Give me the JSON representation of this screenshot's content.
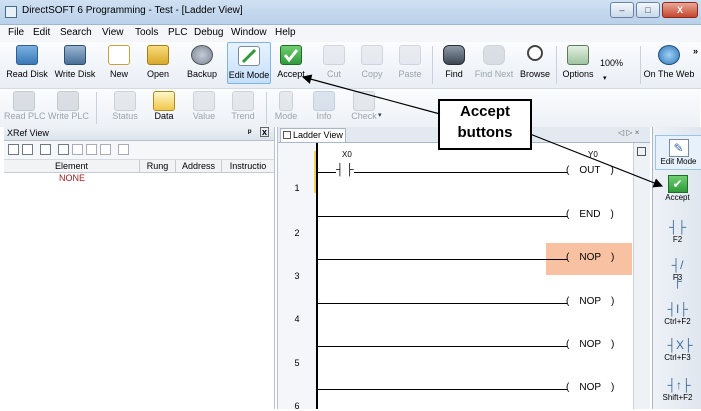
{
  "window": {
    "title": "DirectSOFT 6 Programming - Test - [Ladder View]",
    "min_label": "–",
    "max_label": "□",
    "close_label": "X"
  },
  "menu": [
    "File",
    "Edit",
    "Search",
    "View",
    "Tools",
    "PLC",
    "Debug",
    "Window",
    "Help"
  ],
  "toolbar1": {
    "items": [
      {
        "label": "Read Disk",
        "icon": "read-disk-icon",
        "enabled": true
      },
      {
        "label": "Write Disk",
        "icon": "write-disk-icon",
        "enabled": true
      },
      {
        "label": "New",
        "icon": "new-icon",
        "enabled": true
      },
      {
        "label": "Open",
        "icon": "open-folder-icon",
        "enabled": true
      },
      {
        "label": "Backup",
        "icon": "backup-icon",
        "enabled": true
      },
      {
        "label": "Edit Mode",
        "icon": "edit-mode-icon",
        "enabled": true,
        "selected": true
      },
      {
        "label": "Accept",
        "icon": "accept-checkmark-icon",
        "enabled": true
      },
      {
        "label": "Cut",
        "icon": "cut-icon",
        "enabled": false
      },
      {
        "label": "Copy",
        "icon": "copy-icon",
        "enabled": false
      },
      {
        "label": "Paste",
        "icon": "paste-icon",
        "enabled": false
      },
      {
        "label": "Find",
        "icon": "binoculars-icon",
        "enabled": true
      },
      {
        "label": "Find Next",
        "icon": "find-next-icon",
        "enabled": false
      },
      {
        "label": "Browse",
        "icon": "browse-icon",
        "enabled": true
      },
      {
        "label": "Options",
        "icon": "options-icon",
        "enabled": true
      },
      {
        "label": "On The Web",
        "icon": "web-icon",
        "enabled": true
      }
    ],
    "zoom": "100%",
    "overflow": "»"
  },
  "toolbar2": {
    "items": [
      {
        "label": "Read PLC",
        "icon": "read-plc-icon",
        "enabled": false
      },
      {
        "label": "Write PLC",
        "icon": "write-plc-icon",
        "enabled": false
      },
      {
        "label": "Status",
        "icon": "status-icon",
        "enabled": false
      },
      {
        "label": "Data",
        "icon": "data-icon",
        "enabled": true
      },
      {
        "label": "Value",
        "icon": "value-icon",
        "enabled": false
      },
      {
        "label": "Trend",
        "icon": "trend-icon",
        "enabled": false
      },
      {
        "label": "Mode",
        "icon": "mode-icon",
        "enabled": false
      },
      {
        "label": "Info",
        "icon": "info-icon",
        "enabled": false
      },
      {
        "label": "Check",
        "icon": "check-icon",
        "enabled": false
      }
    ]
  },
  "xref": {
    "title": "XRef View",
    "pin_label": "ᵖ",
    "close_label": "x",
    "columns": [
      "Element",
      "Rung",
      "Address",
      "Instructio"
    ],
    "rows": [
      {
        "element": "NONE",
        "rung": "",
        "address": "",
        "instruction": ""
      }
    ]
  },
  "ladder": {
    "tab_label": "Ladder View",
    "tab_controls": "◁ ▷ ×",
    "rungs": [
      {
        "num": "1",
        "contact": "X0",
        "coil_addr": "Y0",
        "coil": "OUT"
      },
      {
        "num": "2",
        "coil": "END"
      },
      {
        "num": "3",
        "coil": "NOP",
        "highlighted": true
      },
      {
        "num": "4",
        "coil": "NOP"
      },
      {
        "num": "5",
        "coil": "NOP"
      },
      {
        "num": "6",
        "coil": "NOP"
      }
    ]
  },
  "palette": {
    "items": [
      {
        "label": "Edit Mode",
        "icon": "edit-mode-icon"
      },
      {
        "label": "Accept",
        "icon": "accept-checkmark-icon"
      },
      {
        "label": "F2",
        "icon": "normally-open-contact-icon"
      },
      {
        "label": "F3",
        "icon": "normally-closed-contact-icon"
      },
      {
        "label": "Ctrl+F2",
        "icon": "open-contact-alt-icon"
      },
      {
        "label": "Ctrl+F3",
        "icon": "closed-contact-alt-icon"
      },
      {
        "label": "Shift+F2",
        "icon": "edge-contact-icon"
      }
    ]
  },
  "callout": {
    "line1": "Accept",
    "line2": "buttons"
  },
  "colors": {
    "highlight": "#f5b088",
    "accept_green": "#2f9a3a",
    "title_bar": "#c4d9ee"
  }
}
